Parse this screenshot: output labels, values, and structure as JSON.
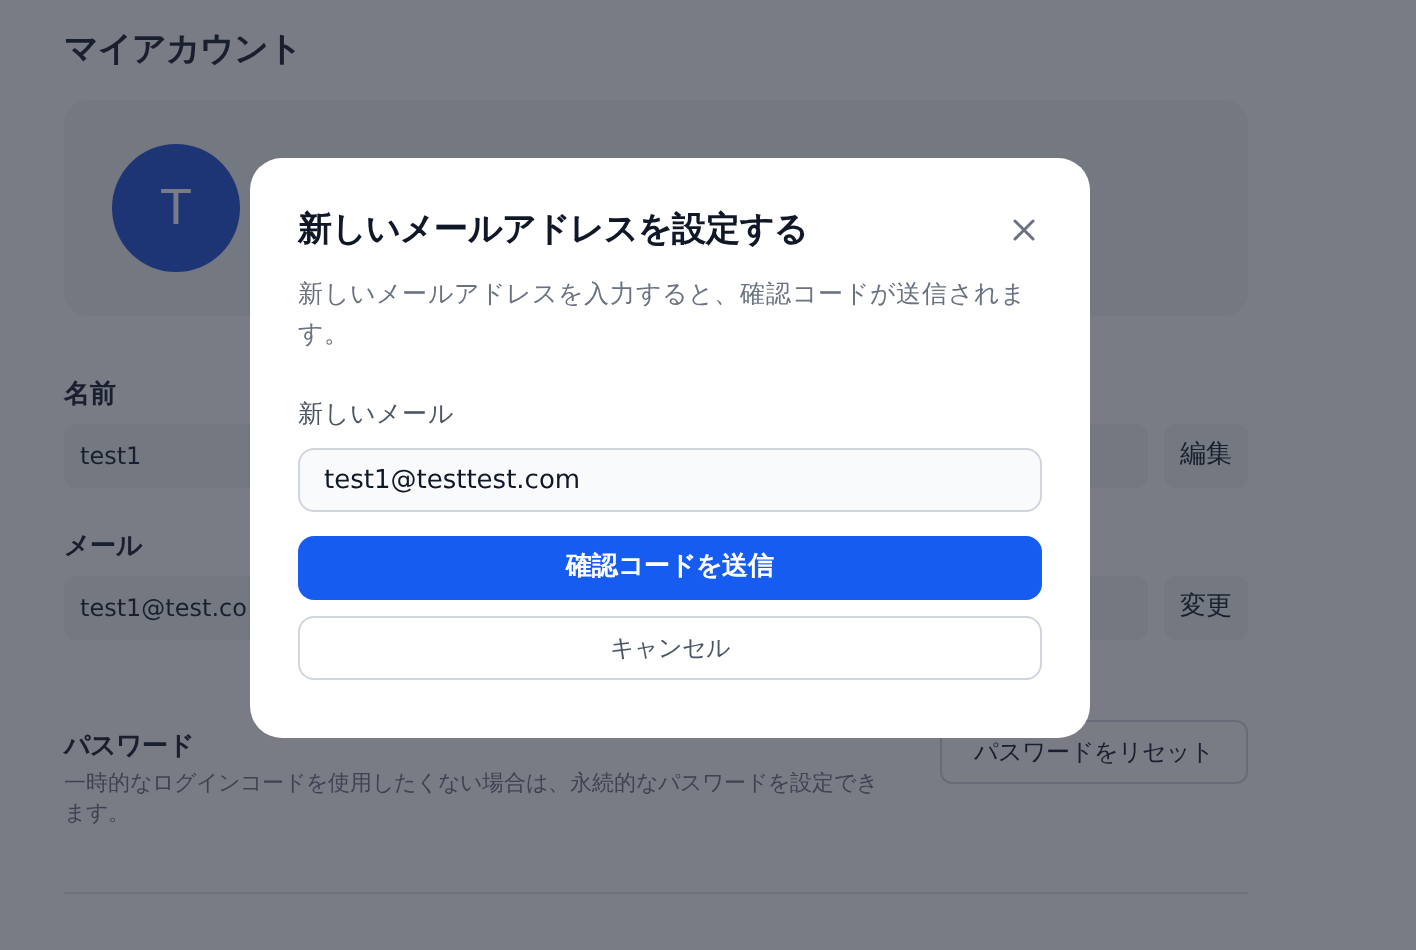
{
  "page": {
    "title": "マイアカウント"
  },
  "profile": {
    "avatar_letter": "T"
  },
  "fields": [
    {
      "label": "名前",
      "value": "test1",
      "button": "編集"
    },
    {
      "label": "メール",
      "value": "test1@test.co",
      "button": "変更"
    }
  ],
  "password": {
    "label": "パスワード",
    "description": "一時的なログインコードを使用したくない場合は、永続的なパスワードを設定できます。",
    "button": "パスワードをリセット"
  },
  "dialog": {
    "title": "新しいメールアドレスを設定する",
    "description": "新しいメールアドレスを入力すると、確認コードが送信されます。",
    "field_label": "新しいメール",
    "field_value": "test1@testtest.com",
    "submit": "確認コードを送信",
    "cancel": "キャンセル"
  }
}
